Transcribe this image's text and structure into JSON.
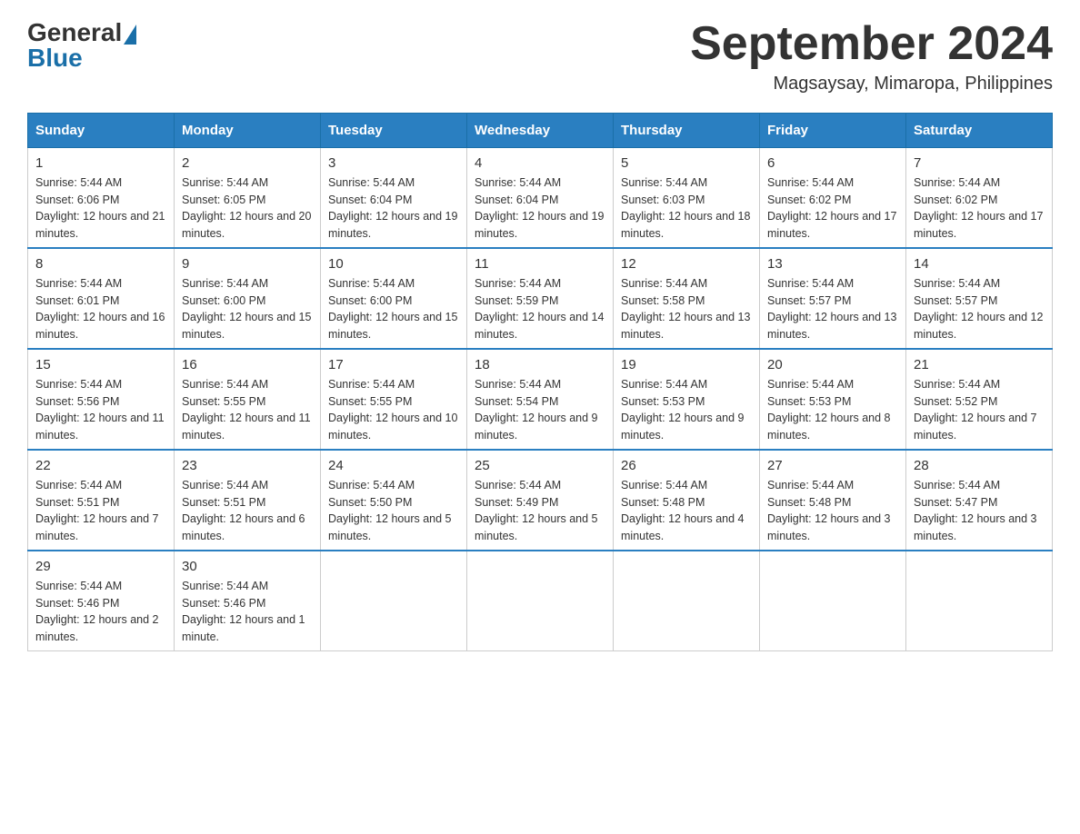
{
  "header": {
    "logo_general": "General",
    "logo_blue": "Blue",
    "month_title": "September 2024",
    "location": "Magsaysay, Mimaropa, Philippines"
  },
  "days_of_week": [
    "Sunday",
    "Monday",
    "Tuesday",
    "Wednesday",
    "Thursday",
    "Friday",
    "Saturday"
  ],
  "weeks": [
    [
      {
        "day": "1",
        "sunrise": "5:44 AM",
        "sunset": "6:06 PM",
        "daylight": "12 hours and 21 minutes."
      },
      {
        "day": "2",
        "sunrise": "5:44 AM",
        "sunset": "6:05 PM",
        "daylight": "12 hours and 20 minutes."
      },
      {
        "day": "3",
        "sunrise": "5:44 AM",
        "sunset": "6:04 PM",
        "daylight": "12 hours and 19 minutes."
      },
      {
        "day": "4",
        "sunrise": "5:44 AM",
        "sunset": "6:04 PM",
        "daylight": "12 hours and 19 minutes."
      },
      {
        "day": "5",
        "sunrise": "5:44 AM",
        "sunset": "6:03 PM",
        "daylight": "12 hours and 18 minutes."
      },
      {
        "day": "6",
        "sunrise": "5:44 AM",
        "sunset": "6:02 PM",
        "daylight": "12 hours and 17 minutes."
      },
      {
        "day": "7",
        "sunrise": "5:44 AM",
        "sunset": "6:02 PM",
        "daylight": "12 hours and 17 minutes."
      }
    ],
    [
      {
        "day": "8",
        "sunrise": "5:44 AM",
        "sunset": "6:01 PM",
        "daylight": "12 hours and 16 minutes."
      },
      {
        "day": "9",
        "sunrise": "5:44 AM",
        "sunset": "6:00 PM",
        "daylight": "12 hours and 15 minutes."
      },
      {
        "day": "10",
        "sunrise": "5:44 AM",
        "sunset": "6:00 PM",
        "daylight": "12 hours and 15 minutes."
      },
      {
        "day": "11",
        "sunrise": "5:44 AM",
        "sunset": "5:59 PM",
        "daylight": "12 hours and 14 minutes."
      },
      {
        "day": "12",
        "sunrise": "5:44 AM",
        "sunset": "5:58 PM",
        "daylight": "12 hours and 13 minutes."
      },
      {
        "day": "13",
        "sunrise": "5:44 AM",
        "sunset": "5:57 PM",
        "daylight": "12 hours and 13 minutes."
      },
      {
        "day": "14",
        "sunrise": "5:44 AM",
        "sunset": "5:57 PM",
        "daylight": "12 hours and 12 minutes."
      }
    ],
    [
      {
        "day": "15",
        "sunrise": "5:44 AM",
        "sunset": "5:56 PM",
        "daylight": "12 hours and 11 minutes."
      },
      {
        "day": "16",
        "sunrise": "5:44 AM",
        "sunset": "5:55 PM",
        "daylight": "12 hours and 11 minutes."
      },
      {
        "day": "17",
        "sunrise": "5:44 AM",
        "sunset": "5:55 PM",
        "daylight": "12 hours and 10 minutes."
      },
      {
        "day": "18",
        "sunrise": "5:44 AM",
        "sunset": "5:54 PM",
        "daylight": "12 hours and 9 minutes."
      },
      {
        "day": "19",
        "sunrise": "5:44 AM",
        "sunset": "5:53 PM",
        "daylight": "12 hours and 9 minutes."
      },
      {
        "day": "20",
        "sunrise": "5:44 AM",
        "sunset": "5:53 PM",
        "daylight": "12 hours and 8 minutes."
      },
      {
        "day": "21",
        "sunrise": "5:44 AM",
        "sunset": "5:52 PM",
        "daylight": "12 hours and 7 minutes."
      }
    ],
    [
      {
        "day": "22",
        "sunrise": "5:44 AM",
        "sunset": "5:51 PM",
        "daylight": "12 hours and 7 minutes."
      },
      {
        "day": "23",
        "sunrise": "5:44 AM",
        "sunset": "5:51 PM",
        "daylight": "12 hours and 6 minutes."
      },
      {
        "day": "24",
        "sunrise": "5:44 AM",
        "sunset": "5:50 PM",
        "daylight": "12 hours and 5 minutes."
      },
      {
        "day": "25",
        "sunrise": "5:44 AM",
        "sunset": "5:49 PM",
        "daylight": "12 hours and 5 minutes."
      },
      {
        "day": "26",
        "sunrise": "5:44 AM",
        "sunset": "5:48 PM",
        "daylight": "12 hours and 4 minutes."
      },
      {
        "day": "27",
        "sunrise": "5:44 AM",
        "sunset": "5:48 PM",
        "daylight": "12 hours and 3 minutes."
      },
      {
        "day": "28",
        "sunrise": "5:44 AM",
        "sunset": "5:47 PM",
        "daylight": "12 hours and 3 minutes."
      }
    ],
    [
      {
        "day": "29",
        "sunrise": "5:44 AM",
        "sunset": "5:46 PM",
        "daylight": "12 hours and 2 minutes."
      },
      {
        "day": "30",
        "sunrise": "5:44 AM",
        "sunset": "5:46 PM",
        "daylight": "12 hours and 1 minute."
      },
      null,
      null,
      null,
      null,
      null
    ]
  ]
}
